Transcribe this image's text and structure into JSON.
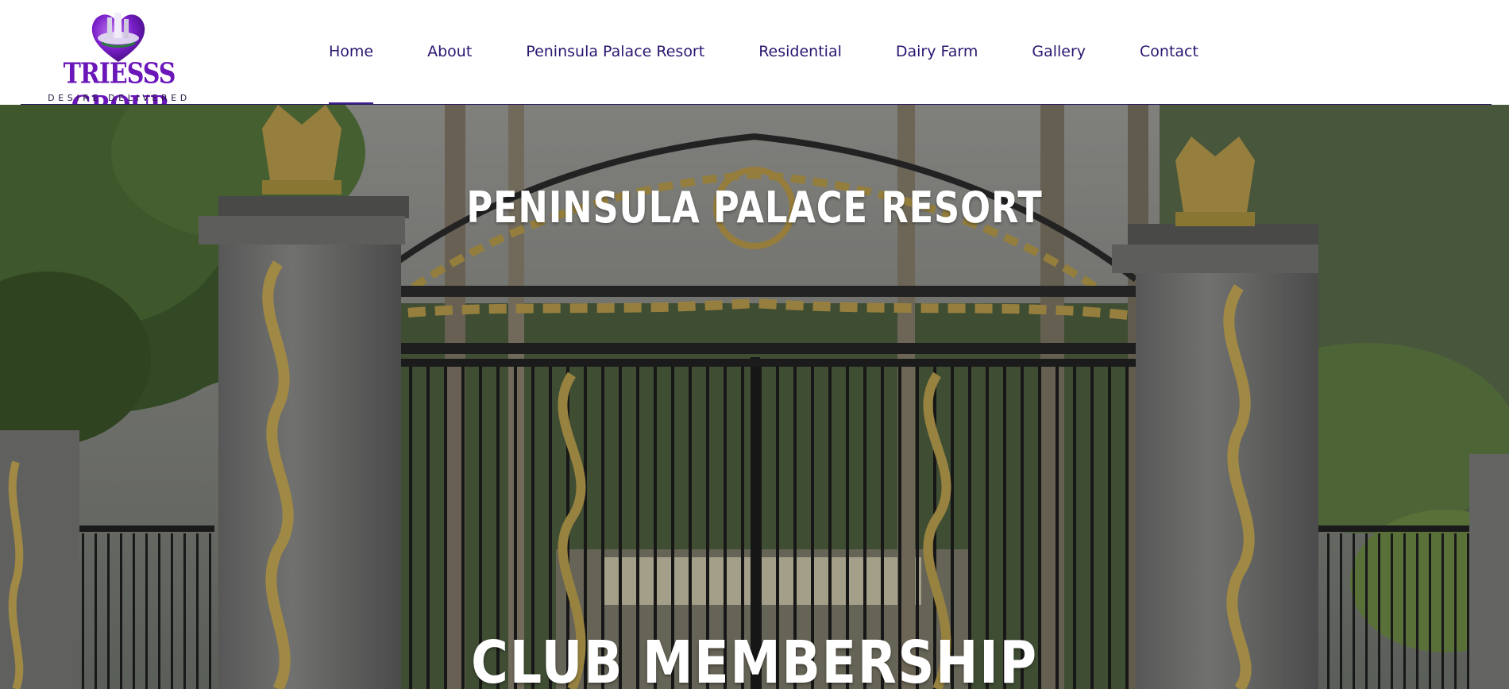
{
  "brand": {
    "name": "TRIESSS GROUP",
    "tagline": "DESIRE DELIVERED",
    "color": "#6a16b9"
  },
  "nav": {
    "items": [
      {
        "label": "Home",
        "active": true
      },
      {
        "label": "About"
      },
      {
        "label": "Peninsula Palace Resort"
      },
      {
        "label": "Residential"
      },
      {
        "label": "Dairy Farm"
      },
      {
        "label": "Gallery"
      },
      {
        "label": "Contact"
      }
    ],
    "text_color": "#2b1570"
  },
  "hero": {
    "title": "PENINSULA PALACE RESORT",
    "subtitle": "CLUB MEMBERSHIP"
  }
}
